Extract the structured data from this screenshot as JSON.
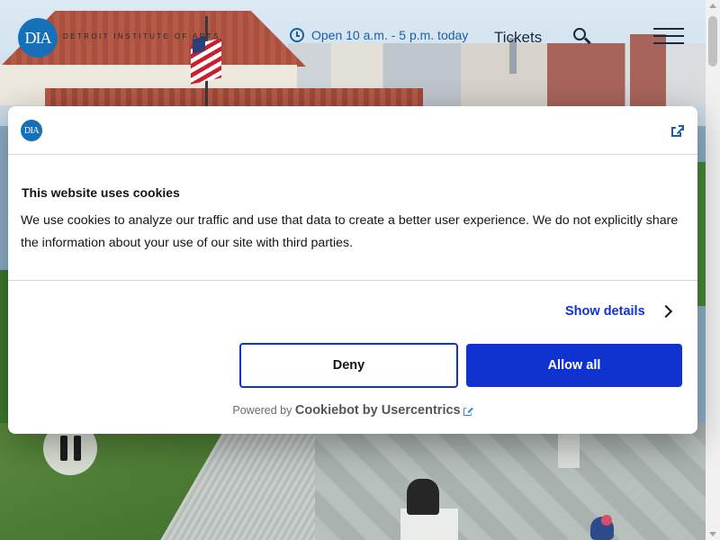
{
  "header": {
    "logo_text": "DIA",
    "brand_name": "DETROIT INSTITUTE OF ARTS",
    "hours_text": "Open 10 a.m. - 5 p.m. today",
    "tickets_label": "Tickets",
    "icons": {
      "clock": "clock-icon",
      "search": "search-icon",
      "menu": "hamburger-menu-icon"
    }
  },
  "hero": {
    "pause_icon": "pause-icon"
  },
  "cookie_dialog": {
    "logo_text": "DIA",
    "title": "This website uses cookies",
    "body": "We use cookies to analyze our traffic and use that data to create a better user experience. We do not explicitly share the information about your use of our site with third parties.",
    "show_details_label": "Show details",
    "deny_label": "Deny",
    "allow_label": "Allow all",
    "powered_prefix": "Powered by",
    "powered_brand": "Cookiebot by Usercentrics",
    "colors": {
      "primary": "#1032cf",
      "link_icon": "#1a5fa6"
    }
  },
  "colors": {
    "brand_blue": "#1570b8",
    "hours_blue": "#1a5fa6"
  }
}
